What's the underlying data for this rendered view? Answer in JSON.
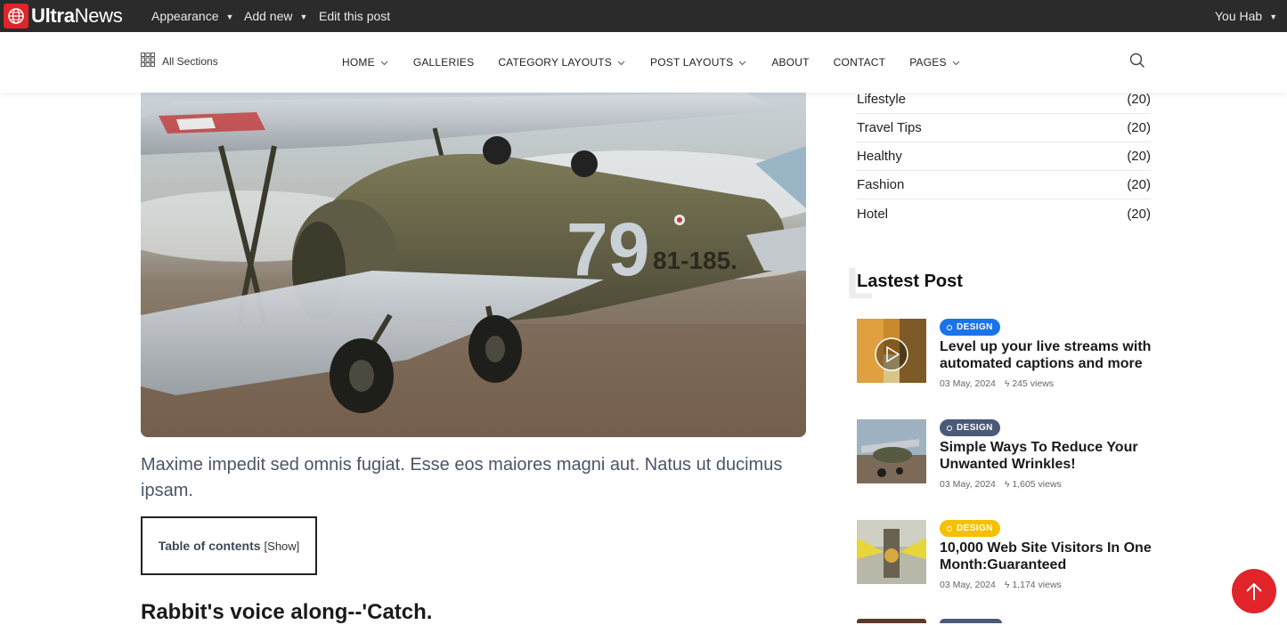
{
  "adminbar": {
    "brand_bold": "Ultra",
    "brand_thin": "News",
    "appearance": "Appearance",
    "add_new": "Add new",
    "edit_post": "Edit this post",
    "user": "You Hab",
    "brand_color": "#e0242a"
  },
  "header": {
    "all_sections": "All Sections",
    "nav": [
      "HOME",
      "GALLERIES",
      "CATEGORY LAYOUTS",
      "POST LAYOUTS",
      "ABOUT",
      "CONTACT",
      "PAGES"
    ]
  },
  "article": {
    "lead": "Maxime impedit sed omnis fugiat. Esse eos maiores magni aut. Natus ut ducimus ipsam.",
    "toc_label": "Table of contents",
    "toc_toggle": "[Show]",
    "subheading": "Rabbit's voice along--'Catch.",
    "hero_plane_number": "79",
    "hero_plane_reg": "81-185."
  },
  "sidebar": {
    "categories": [
      {
        "name": "Lifestyle",
        "count": "(20)"
      },
      {
        "name": "Travel Tips",
        "count": "(20)"
      },
      {
        "name": "Healthy",
        "count": "(20)"
      },
      {
        "name": "Fashion",
        "count": "(20)"
      },
      {
        "name": "Hotel",
        "count": "(20)"
      }
    ],
    "latest_title": "Lastest Post",
    "latest_bg_letter": "L",
    "posts": [
      {
        "tag": "DESIGN",
        "tag_color": "#1a73e8",
        "title": "Level up your live streams with automated captions and more",
        "date": "03 May, 2024",
        "views": "245 views"
      },
      {
        "tag": "DESIGN",
        "tag_color": "#4a5a78",
        "title": "Simple Ways To Reduce Your Unwanted Wrinkles!",
        "date": "03 May, 2024",
        "views": "1,605 views"
      },
      {
        "tag": "DESIGN",
        "tag_color": "#f5c000",
        "title": "10,000 Web Site Visitors In One Month:Guaranteed",
        "date": "03 May, 2024",
        "views": "1,174 views"
      }
    ]
  }
}
